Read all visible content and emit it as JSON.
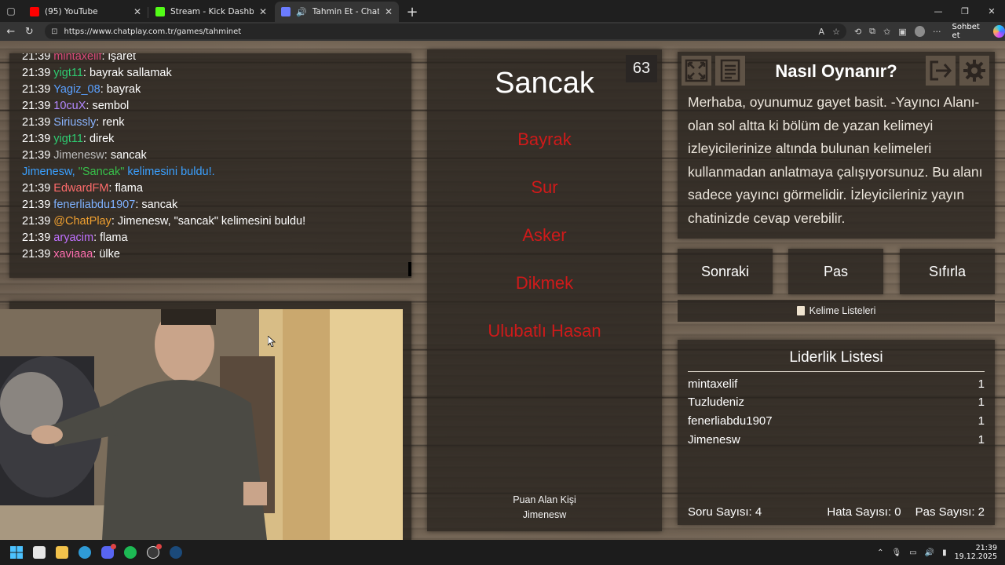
{
  "browser": {
    "tabs": [
      {
        "title": "(95) YouTube",
        "active": false,
        "fav_color": "#ff0000"
      },
      {
        "title": "Stream - Kick Dashboard",
        "active": false,
        "fav_color": "#53fc18"
      },
      {
        "title": "Tahmin Et - ChatPlay",
        "active": true,
        "fav_color": "#6b7cff"
      }
    ],
    "url": "https://www.chatplay.com.tr/games/tahminet",
    "copilot_label": "Sohbet et"
  },
  "chat": {
    "lines": [
      {
        "time": "21:39",
        "user": "mintaxelif",
        "color": "#d94a7a",
        "msg": ": işaret"
      },
      {
        "time": "21:39",
        "user": "yigt11",
        "color": "#2ecc71",
        "msg": ": bayrak sallamak"
      },
      {
        "time": "21:39",
        "user": "Yagiz_08",
        "color": "#5aa0ff",
        "msg": ": bayrak"
      },
      {
        "time": "21:39",
        "user": "10cuX",
        "color": "#b388ff",
        "msg": ": sembol"
      },
      {
        "time": "21:39",
        "user": "Siriussly",
        "color": "#8ab4ff",
        "msg": ": renk"
      },
      {
        "time": "21:39",
        "user": "yigt11",
        "color": "#2ecc71",
        "msg": ": direk"
      },
      {
        "time": "21:39",
        "user": "Jimenesw",
        "color": "#bdbdbd",
        "msg": ": sancak"
      },
      {
        "notice": true,
        "pre": "Jimenesw, ",
        "hl": "\"Sancak\"",
        "post": " kelimesini buldu!."
      },
      {
        "time": "21:39",
        "user": "EdwardFM",
        "color": "#ff6b6b",
        "msg": ": flama"
      },
      {
        "time": "21:39",
        "user": "fenerliabdu1907",
        "color": "#7fb2ff",
        "msg": ": sancak"
      },
      {
        "time": "21:39",
        "user": "@ChatPlay",
        "color": "#f0a030",
        "msg": ": Jimenesw, \"sancak\" kelimesini buldu!"
      },
      {
        "time": "21:39",
        "user": "aryacim",
        "color": "#c070ff",
        "msg": ": flama"
      },
      {
        "time": "21:39",
        "user": "xaviaaa",
        "color": "#ff6fb0",
        "msg": ": ülke"
      }
    ]
  },
  "game": {
    "counter": "63",
    "word": "Sancak",
    "taboo": [
      "Bayrak",
      "Sur",
      "Asker",
      "Dikmek",
      "Ulubatlı Hasan"
    ],
    "scorer_label": "Puan Alan Kişi",
    "scorer_name": "Jimenesw"
  },
  "howto": {
    "title": "Nasıl Oynanır?",
    "text": "Merhaba, oyunumuz gayet basit. -Yayıncı Alanı- olan sol altta ki bölüm de yazan kelimeyi izleyicilerinize altında bulunan kelimeleri kullanmadan anlatmaya çalışıyorsunuz. Bu alanı sadece yayıncı görmelidir. İzleyicileriniz yayın chatinizde cevap verebilir."
  },
  "controls": {
    "next": "Sonraki",
    "pass": "Pas",
    "reset": "Sıfırla",
    "word_lists": "Kelime Listeleri"
  },
  "leaderboard": {
    "title": "Liderlik Listesi",
    "rows": [
      {
        "name": "mintaxelif",
        "score": "1"
      },
      {
        "name": "Tuzludeniz",
        "score": "1"
      },
      {
        "name": "fenerliabdu1907",
        "score": "1"
      },
      {
        "name": "Jimenesw",
        "score": "1"
      }
    ],
    "questions": "Soru Sayısı: 4",
    "errors": "Hata Sayısı: 0",
    "passes": "Pas Sayısı: 2"
  },
  "taskbar": {
    "time": "21:39",
    "date": "19.12.2025"
  }
}
